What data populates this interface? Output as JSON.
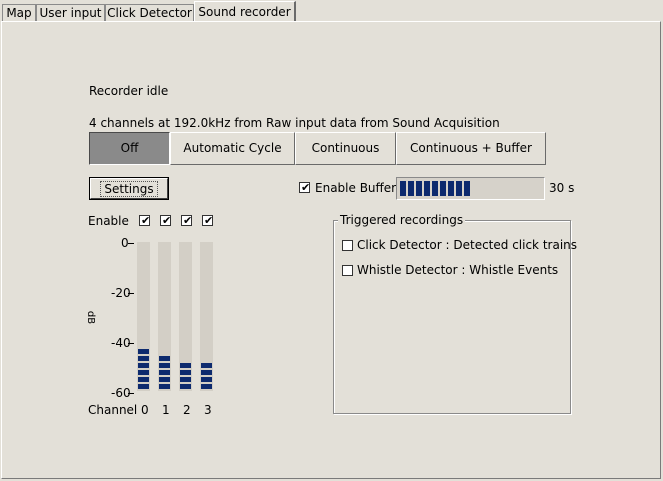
{
  "tabs": [
    "Map",
    "User input",
    "Click Detector",
    "Sound recorder"
  ],
  "active_tab": "Sound recorder",
  "status": {
    "state": "Recorder idle",
    "channels_info": "4 channels at 192.0kHz from Raw input data from Sound Acquisition"
  },
  "modes": [
    "Off",
    "Automatic Cycle",
    "Continuous",
    "Continuous + Buffer"
  ],
  "selected_mode": "Off",
  "settings_label": "Settings",
  "buffer": {
    "enable_label": "Enable Buffer",
    "enabled": true,
    "fill_fraction": 0.48,
    "duration_label": "30 s"
  },
  "enable_label": "Enable",
  "channels": {
    "label": "Channel",
    "ids": [
      "0",
      "1",
      "2",
      "3"
    ],
    "enabled": [
      true,
      true,
      true,
      true
    ],
    "levels_db": [
      -44,
      -46,
      -49,
      -50
    ]
  },
  "level_axis": {
    "unit": "dB",
    "ticks": [
      "0",
      "-20",
      "-40",
      "-60"
    ]
  },
  "triggered": {
    "title": "Triggered recordings",
    "items": [
      {
        "label": "Click Detector : Detected click trains",
        "checked": false
      },
      {
        "label": "Whistle Detector : Whistle Events",
        "checked": false
      }
    ]
  },
  "colors": {
    "background": "#e3e0d8",
    "meter_fill": "#0d2a6e",
    "meter_track": "#d3cfc6",
    "selected_button": "#8a8a8a"
  }
}
